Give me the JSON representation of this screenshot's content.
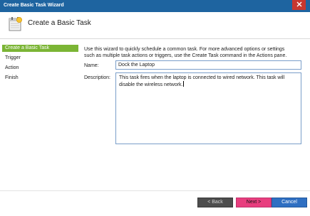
{
  "window": {
    "title": "Create Basic Task Wizard"
  },
  "header": {
    "title": "Create a Basic Task"
  },
  "sidebar": {
    "items": [
      {
        "label": "Create a Basic Task",
        "active": true
      },
      {
        "label": "Trigger",
        "active": false
      },
      {
        "label": "Action",
        "active": false
      },
      {
        "label": "Finish",
        "active": false
      }
    ]
  },
  "main": {
    "intro_line1": "Use this wizard to quickly schedule a common task.  For more advanced options or settings",
    "intro_line2": "such as multiple task actions or triggers, use the Create Task command in the Actions pane.",
    "name_label": "Name:",
    "name_value": "Dock the Laptop",
    "description_label": "Description:",
    "description_line1": "This task fires when the laptop is connected to wired network. This task will",
    "description_line2": "disable the wireless network."
  },
  "buttons": {
    "back": "< Back",
    "next": "Next >",
    "cancel": "Cancel"
  },
  "colors": {
    "titlebar": "#1e64a0",
    "close": "#c7372f",
    "active_nav": "#7bb535",
    "back_button": "#4d4d4d",
    "next_button": "#e83e7e",
    "cancel_button": "#2f6fc2"
  },
  "icons": {
    "header": "task-scheduler-calendar-icon",
    "close": "close-icon"
  }
}
